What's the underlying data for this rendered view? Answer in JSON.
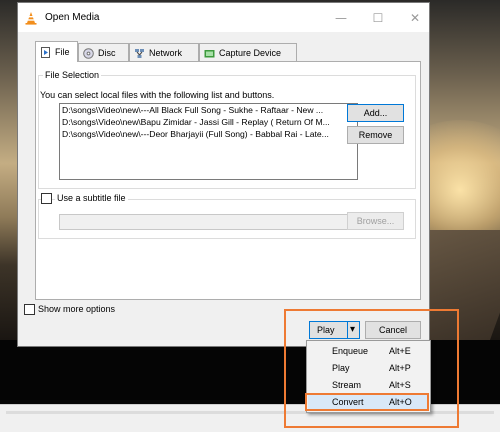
{
  "window": {
    "title": "Open Media",
    "minimize_symbol": "—",
    "maximize_symbol": "☐",
    "close_symbol": "✕"
  },
  "tabs": [
    {
      "label": "File",
      "icon": "file-icon",
      "active": true
    },
    {
      "label": "Disc",
      "icon": "disc-icon",
      "active": false
    },
    {
      "label": "Network",
      "icon": "network-icon",
      "active": false
    },
    {
      "label": "Capture Device",
      "icon": "capture-device-icon",
      "active": false
    }
  ],
  "file_selection": {
    "group_label": "File Selection",
    "info_text": "You can select local files with the following list and buttons.",
    "files": [
      "D:\\songs\\Video\\new\\---All Black Full Song - Sukhe - Raftaar -  New ...",
      "D:\\songs\\Video\\new\\Bapu Zimidar - Jassi Gill - Replay ( Return Of M...",
      "D:\\songs\\Video\\new\\---Deor Bharjayii (Full Song) - Babbal Rai - Late..."
    ],
    "add_button": "Add...",
    "remove_button": "Remove"
  },
  "subtitle": {
    "checkbox_label": "Use a subtitle file",
    "checked": false,
    "browse_button": "Browse..."
  },
  "show_more_options": {
    "label": "Show more options",
    "checked": false
  },
  "footer": {
    "play_button": "Play",
    "dropdown_arrow": "▾",
    "cancel_button": "Cancel"
  },
  "play_menu": [
    {
      "label": "Enqueue",
      "shortcut": "Alt+E"
    },
    {
      "label": "Play",
      "shortcut": "Alt+P"
    },
    {
      "label": "Stream",
      "shortcut": "Alt+S"
    },
    {
      "label": "Convert",
      "shortcut": "Alt+O"
    }
  ],
  "colors": {
    "highlight": "#ee7a33",
    "focus_border": "#0078d7",
    "vlc_orange": "#f28e1c"
  }
}
